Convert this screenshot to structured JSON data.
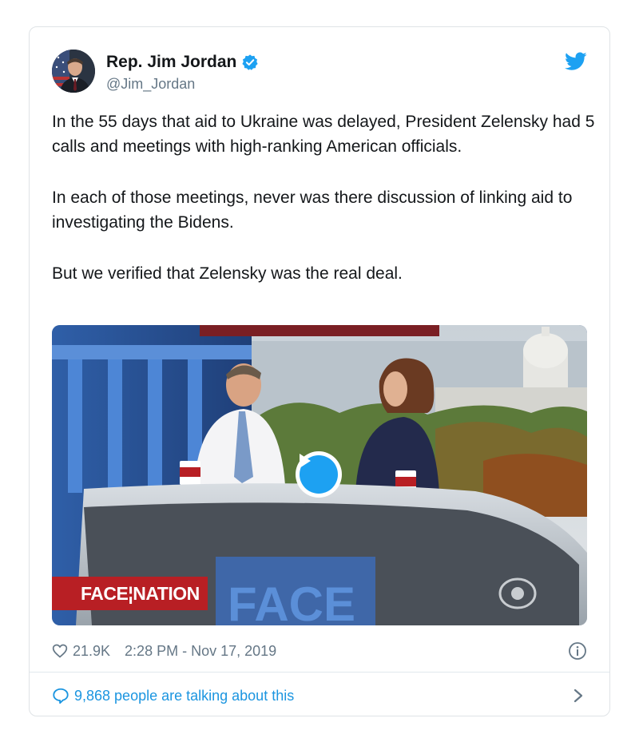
{
  "tweet": {
    "author": {
      "name": "Rep. Jim Jordan",
      "handle": "@Jim_Jordan",
      "verified": true
    },
    "paragraphs": [
      "In the 55 days that aid to Ukraine was delayed, President Zelensky had 5 calls and meetings with high-ranking American officials.",
      "In each of those meetings, never was there discussion of linking aid to investigating the Bidens.",
      "But we verified that Zelensky was the real deal."
    ],
    "media": {
      "logo_text": "FACE¦NATION"
    },
    "likes": "21.9K",
    "timestamp": "2:28 PM - Nov 17, 2019",
    "talking": "9,868 people are talking about this"
  },
  "icons": {
    "verified": "verified-badge-icon",
    "twitter": "twitter-bird-icon",
    "like": "heart-icon",
    "info": "info-icon",
    "reply": "speech-bubble-icon",
    "chevron": "chevron-right-icon",
    "play": "play-icon"
  },
  "colors": {
    "accent": "#1da1f2",
    "link": "#1b95e0",
    "muted": "#657786",
    "brand_red": "#b81f24"
  }
}
